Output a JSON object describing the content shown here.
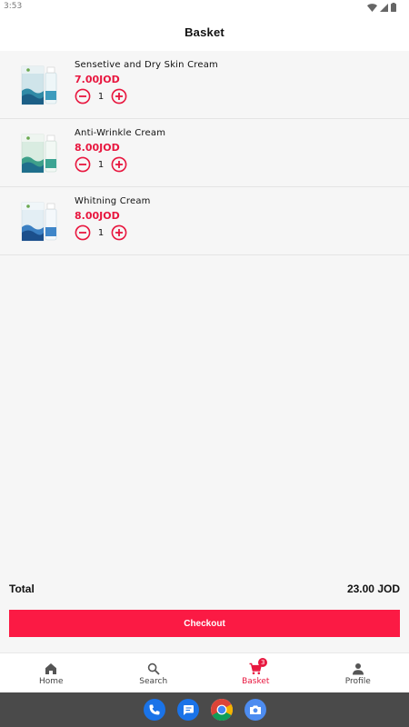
{
  "status_bar": {
    "time": "3:53"
  },
  "header": {
    "title": "Basket"
  },
  "basket": {
    "items": [
      {
        "name": "Sensetive and Dry Skin Cream",
        "price": "7.00JOD",
        "quantity": "1"
      },
      {
        "name": "Anti-Wrinkle Cream",
        "price": "8.00JOD",
        "quantity": "1"
      },
      {
        "name": "Whitning Cream",
        "price": "8.00JOD",
        "quantity": "1"
      }
    ]
  },
  "summary": {
    "total_label": "Total",
    "total_value": "23.00 JOD"
  },
  "checkout": {
    "label": "Checkout"
  },
  "nav": {
    "items": [
      {
        "label": "Home",
        "icon": "home-icon"
      },
      {
        "label": "Search",
        "icon": "search-icon"
      },
      {
        "label": "Basket",
        "icon": "cart-icon",
        "badge": "3"
      },
      {
        "label": "Profile",
        "icon": "person-icon"
      }
    ]
  },
  "dock": {
    "apps": [
      "phone-icon",
      "messages-icon",
      "chrome-icon",
      "camera-icon"
    ]
  },
  "colors": {
    "accent": "#e8173f",
    "checkout": "#fb1a44",
    "background": "#f6f6f6",
    "dock": "#4a4a4a"
  }
}
